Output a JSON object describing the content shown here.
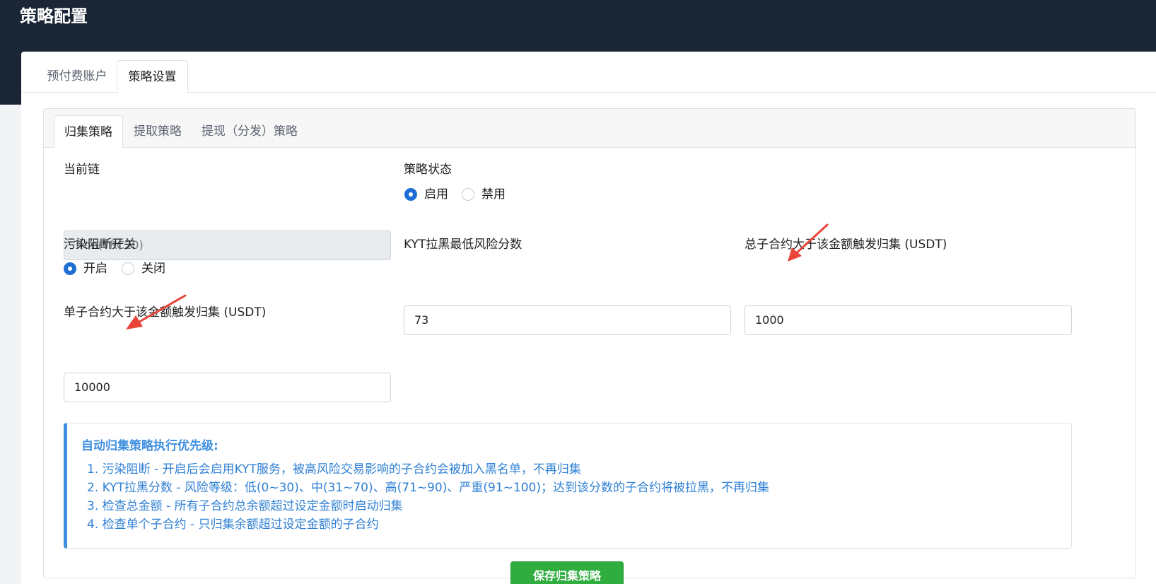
{
  "header": {
    "title": "策略配置"
  },
  "outer_tabs": [
    {
      "label": "预付费账户",
      "active": false
    },
    {
      "label": "策略设置",
      "active": true
    }
  ],
  "inner_tabs": [
    {
      "label": "归集策略",
      "active": true
    },
    {
      "label": "提取策略",
      "active": false
    },
    {
      "label": "提现（分发）策略",
      "active": false
    }
  ],
  "form": {
    "chain": {
      "label": "当前链",
      "value": "Tron(TRC20)",
      "disabled": true
    },
    "status": {
      "label": "策略状态",
      "options": [
        "启用",
        "禁用"
      ],
      "selected": "启用"
    },
    "pollution": {
      "label": "污染阻断开关",
      "options": [
        "开启",
        "关闭"
      ],
      "selected": "开启"
    },
    "kyt": {
      "label": "KYT拉黑最低风险分数",
      "value": "73"
    },
    "total_threshold": {
      "label": "总子合约大于该金额触发归集 (USDT)",
      "value": "1000"
    },
    "single_threshold": {
      "label": "单子合约大于该金额触发归集 (USDT)",
      "value": "10000"
    }
  },
  "info": {
    "title": "自动归集策略执行优先级:",
    "items": [
      "1. 污染阻断 - 开启后会启用KYT服务，被高风险交易影响的子合约会被加入黑名单，不再归集",
      "2. KYT拉黑分数 - 风险等级：低(0~30)、中(31~70)、高(71~90)、严重(91~100)；达到该分数的子合约将被拉黑，不再归集",
      "3. 检查总金额 - 所有子合约总余额超过设定金额时启动归集",
      "4. 检查单个子合约 - 只归集余额超过设定金额的子合约"
    ]
  },
  "actions": {
    "save_label": "保存归集策略"
  },
  "colors": {
    "header_bg": "#1a2536",
    "accent": "#1f6ed4",
    "info": "#3f8fe0",
    "save": "#2fad3f",
    "annotation_arrow": "#e8443a"
  }
}
